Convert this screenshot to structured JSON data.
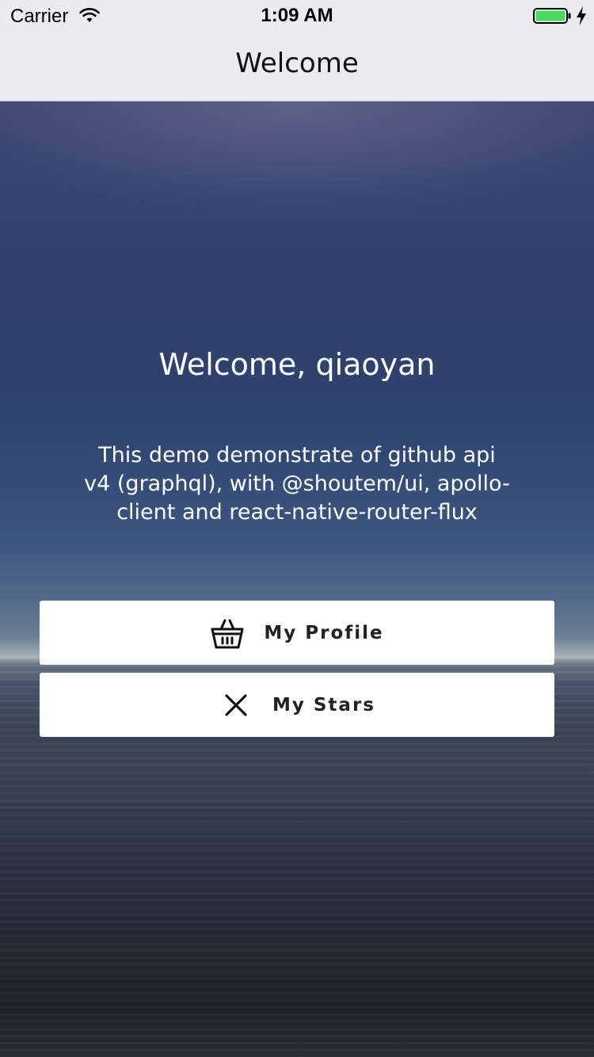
{
  "status_bar": {
    "carrier": "Carrier",
    "time": "1:09 AM",
    "wifi_icon": "wifi-icon",
    "battery_icon": "battery-icon",
    "battery_level": 1.0,
    "battery_color": "#4cd964",
    "charging_icon": "lightning-bolt-icon"
  },
  "nav": {
    "title": "Welcome"
  },
  "main": {
    "greeting": "Welcome, qiaoyan",
    "description": "This demo demonstrate of github api v4 (graphql), with @shoutem/ui, apollo-client and react-native-router-flux",
    "buttons": [
      {
        "label": "My Profile",
        "icon": "basket-icon"
      },
      {
        "label": "My Stars",
        "icon": "close-icon"
      }
    ]
  },
  "colors": {
    "bar_background": "#ebebf0",
    "button_background": "#ffffff",
    "button_text": "#222222",
    "hero_text": "#ffffff"
  }
}
